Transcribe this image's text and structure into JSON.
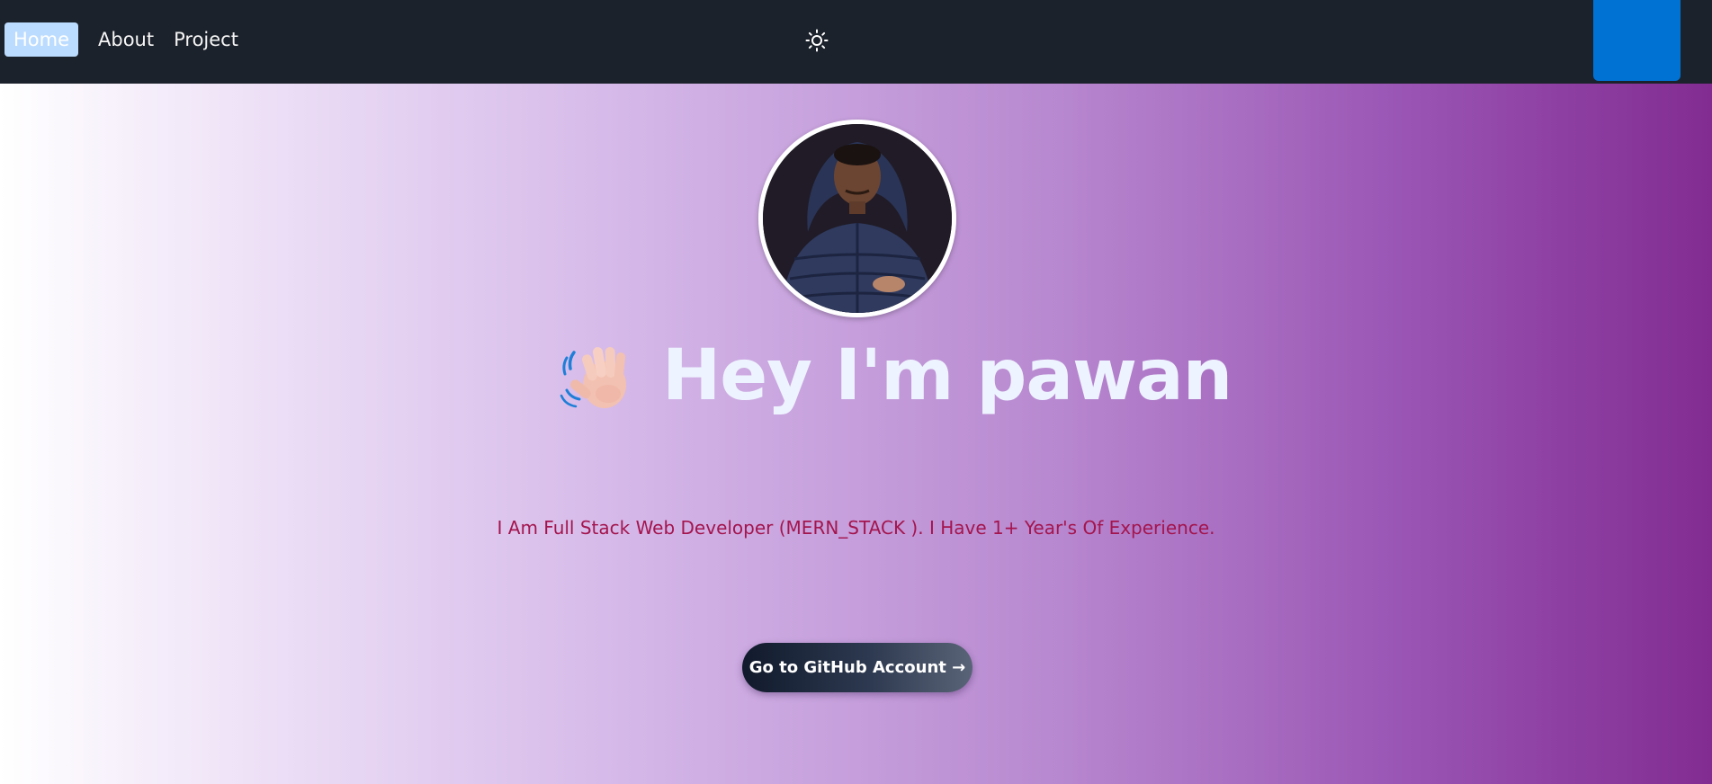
{
  "navbar": {
    "items": [
      {
        "label": "Home",
        "active": true
      },
      {
        "label": "About",
        "active": false
      },
      {
        "label": "Project",
        "active": false
      }
    ],
    "theme_toggle_icon": "sun-icon",
    "corner_block_color": "#0072d3"
  },
  "hero": {
    "avatar": "profile-photo",
    "wave_icon": "waving-hand-icon",
    "headline": "Hey I'm pawan",
    "tagline": "I Am Full Stack Web Developer (MERN_STACK ). I Have 1+ Year's Of Experience.",
    "button_label": "Go to GitHub Account →"
  },
  "colors": {
    "navbar_bg": "#1c222b",
    "active_nav_bg": "#bcdcff",
    "gradient_end": "#822c91",
    "tagline": "#a4154e",
    "headline": "#eef4ff"
  }
}
